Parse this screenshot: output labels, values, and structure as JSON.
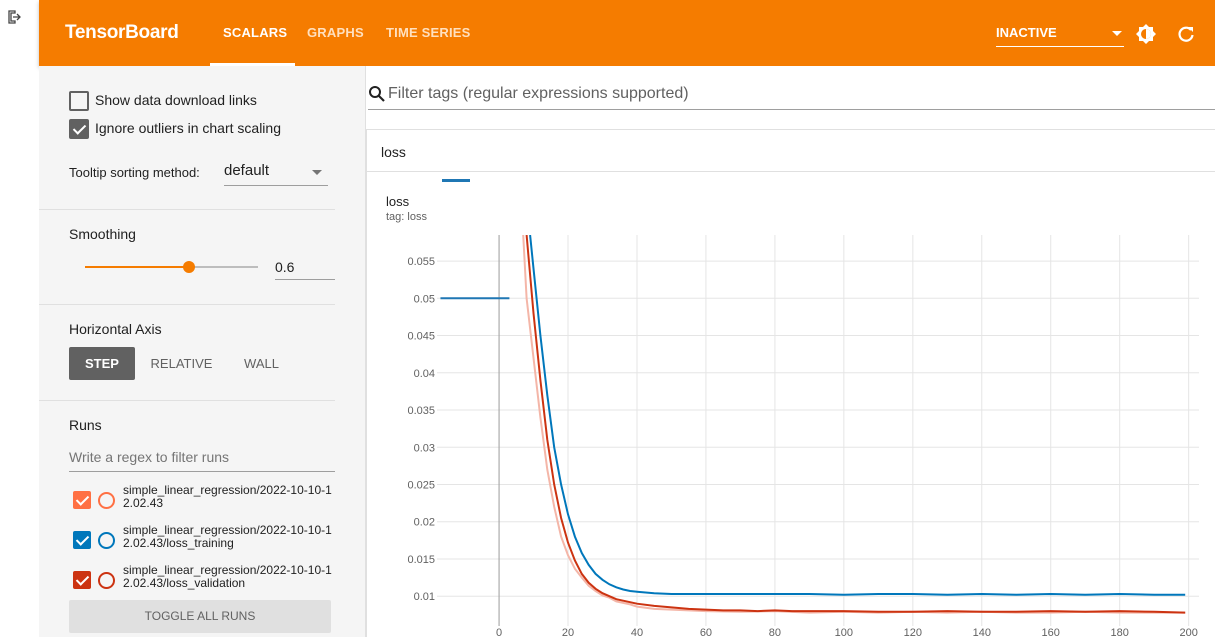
{
  "app": {
    "title": "TensorBoard"
  },
  "tabs": [
    {
      "label": "SCALARS",
      "active": true
    },
    {
      "label": "GRAPHS",
      "active": false
    },
    {
      "label": "TIME SERIES",
      "active": false
    }
  ],
  "reload": {
    "value": "INACTIVE"
  },
  "options": {
    "show_download": {
      "label": "Show data download links",
      "checked": false
    },
    "ignore_outliers": {
      "label": "Ignore outliers in chart scaling",
      "checked": true
    },
    "tooltip_sort": {
      "label": "Tooltip sorting method:",
      "value": "default"
    }
  },
  "smoothing": {
    "title": "Smoothing",
    "value": "0.6",
    "fraction": 0.6
  },
  "horizontal_axis": {
    "title": "Horizontal Axis",
    "buttons": [
      {
        "label": "STEP",
        "active": true
      },
      {
        "label": "RELATIVE",
        "active": false
      },
      {
        "label": "WALL",
        "active": false
      }
    ]
  },
  "runs": {
    "title": "Runs",
    "filter_placeholder": "Write a regex to filter runs",
    "items": [
      {
        "label": "simple_linear_regression/2022-10-10-12.02.43",
        "color": "#ff7043",
        "checked": true
      },
      {
        "label": "simple_linear_regression/2022-10-10-12.02.43/loss_training",
        "color": "#0077bb",
        "checked": true
      },
      {
        "label": "simple_linear_regression/2022-10-10-12.02.43/loss_validation",
        "color": "#cc3311",
        "checked": true
      }
    ],
    "toggle_label": "TOGGLE ALL RUNS"
  },
  "filter": {
    "placeholder": "Filter tags (regular expressions supported)"
  },
  "group": {
    "label": "loss"
  },
  "card": {
    "title": "loss",
    "tag": "tag: loss"
  },
  "chart_data": {
    "type": "line",
    "title": "loss",
    "xlabel": "",
    "ylabel": "",
    "xlim": [
      -18,
      203
    ],
    "ylim": [
      0.006,
      0.0585
    ],
    "xticks": [
      0,
      20,
      40,
      60,
      80,
      100,
      120,
      140,
      160,
      180,
      200
    ],
    "yticks": [
      0.01,
      0.015,
      0.02,
      0.025,
      0.03,
      0.035,
      0.04,
      0.045,
      0.05,
      0.055
    ],
    "grid": true,
    "legend_marker": {
      "x": [
        -17,
        3
      ],
      "y": [
        0.05,
        0.05
      ],
      "color": "#1f77b4"
    },
    "series": [
      {
        "name": "loss_validation (raw)",
        "color": "#f4b6a8",
        "x": [
          7,
          8,
          10,
          12,
          14,
          16,
          18,
          20,
          22,
          24,
          26,
          28,
          30,
          32,
          34,
          36,
          38,
          40,
          45,
          50,
          55,
          60,
          70,
          80,
          90,
          100,
          110,
          120,
          130,
          140,
          150,
          160,
          170,
          180,
          190,
          199
        ],
        "y": [
          0.0585,
          0.05,
          0.042,
          0.034,
          0.027,
          0.022,
          0.018,
          0.0155,
          0.0137,
          0.0125,
          0.0114,
          0.0107,
          0.0101,
          0.0098,
          0.0093,
          0.0091,
          0.0089,
          0.0086,
          0.0083,
          0.0082,
          0.0081,
          0.008,
          0.0079,
          0.008,
          0.0078,
          0.0079,
          0.0078,
          0.0079,
          0.0078,
          0.0079,
          0.0078,
          0.0078,
          0.0079,
          0.0078,
          0.0078,
          0.0078
        ]
      },
      {
        "name": "loss_validation",
        "color": "#cc3311",
        "x": [
          8,
          10,
          12,
          14,
          16,
          18,
          20,
          22,
          24,
          26,
          28,
          30,
          32,
          34,
          36,
          38,
          40,
          45,
          50,
          55,
          60,
          65,
          70,
          75,
          80,
          85,
          90,
          100,
          110,
          120,
          130,
          140,
          150,
          160,
          170,
          180,
          190,
          199
        ],
        "y": [
          0.0585,
          0.048,
          0.039,
          0.031,
          0.025,
          0.0205,
          0.0172,
          0.0148,
          0.013,
          0.0118,
          0.011,
          0.0104,
          0.01,
          0.0096,
          0.0094,
          0.0092,
          0.009,
          0.0087,
          0.0085,
          0.0083,
          0.0082,
          0.0081,
          0.0081,
          0.008,
          0.0081,
          0.008,
          0.008,
          0.008,
          0.0079,
          0.0079,
          0.008,
          0.0079,
          0.0079,
          0.008,
          0.0079,
          0.008,
          0.0079,
          0.0078
        ]
      },
      {
        "name": "loss_training",
        "color": "#0077bb",
        "x": [
          9,
          10,
          12,
          14,
          16,
          18,
          20,
          22,
          24,
          26,
          28,
          30,
          32,
          34,
          36,
          38,
          40,
          45,
          50,
          60,
          70,
          80,
          90,
          100,
          110,
          120,
          130,
          140,
          150,
          160,
          170,
          180,
          190,
          199
        ],
        "y": [
          0.0585,
          0.054,
          0.045,
          0.037,
          0.03,
          0.025,
          0.021,
          0.018,
          0.0158,
          0.0142,
          0.013,
          0.0122,
          0.0116,
          0.0112,
          0.0109,
          0.0107,
          0.0106,
          0.0104,
          0.0103,
          0.0103,
          0.0103,
          0.0103,
          0.0103,
          0.0102,
          0.0103,
          0.0103,
          0.0102,
          0.0103,
          0.0102,
          0.0103,
          0.0102,
          0.0103,
          0.0102,
          0.0102
        ]
      }
    ]
  }
}
